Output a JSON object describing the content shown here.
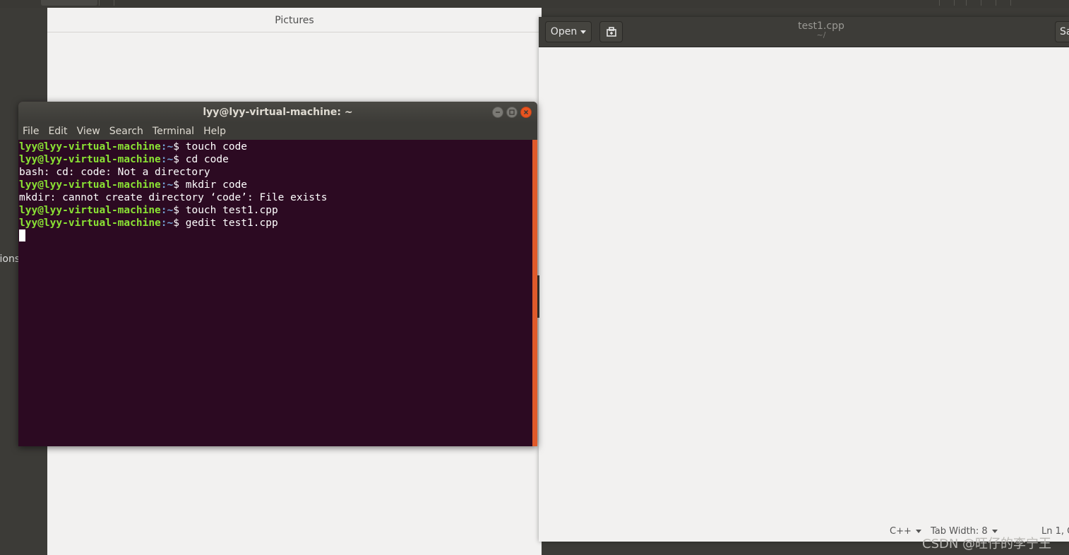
{
  "dock": {
    "partial_label": "tions"
  },
  "files": {
    "title": "Pictures"
  },
  "gedit": {
    "open_label": "Open",
    "title": "test1.cpp",
    "subtitle": "~/",
    "save_label": "Sa",
    "status": {
      "language": "C++",
      "tab_width": "Tab Width: 8",
      "position": "Ln 1, C"
    }
  },
  "terminal": {
    "title": "lyy@lyy-virtual-machine: ~",
    "menu": [
      "File",
      "Edit",
      "View",
      "Search",
      "Terminal",
      "Help"
    ],
    "prompt_user": "lyy@lyy-virtual-machine",
    "prompt_path": ":~",
    "prompt_symbol": "$ ",
    "lines": [
      {
        "type": "cmd",
        "text": "touch code"
      },
      {
        "type": "cmd",
        "text": "cd code"
      },
      {
        "type": "out",
        "text": "bash: cd: code: Not a directory"
      },
      {
        "type": "cmd",
        "text": "mkdir code"
      },
      {
        "type": "out",
        "text": "mkdir: cannot create directory ‘code’: File exists"
      },
      {
        "type": "cmd",
        "text": "touch test1.cpp"
      },
      {
        "type": "cmd",
        "text": "gedit test1.cpp"
      }
    ]
  },
  "watermark": "CSDN @旺仔的李宁王"
}
